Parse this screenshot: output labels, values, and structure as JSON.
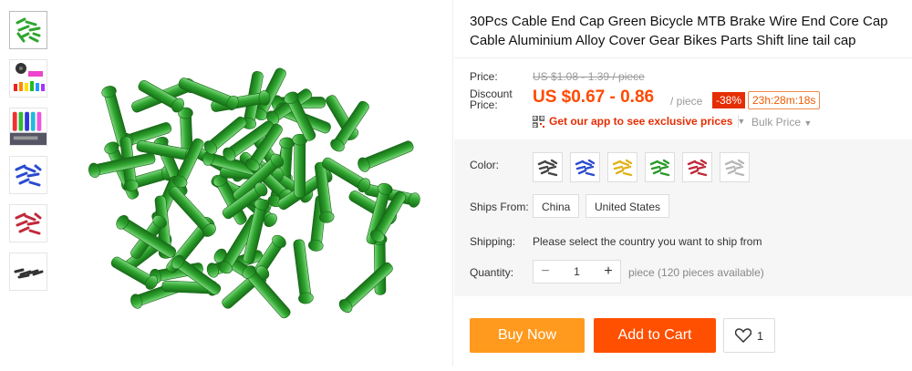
{
  "product": {
    "title": "30Pcs Cable End Cap Green Bicycle MTB Brake Wire End Core Cap Cable Aluminium Alloy Cover Gear Bikes Parts Shift line tail cap"
  },
  "thumbnails": [
    {
      "icon": "green-caps-thumb"
    },
    {
      "icon": "colorful-caps-thumb"
    },
    {
      "icon": "grips-thumb"
    },
    {
      "icon": "blue-caps-thumb"
    },
    {
      "icon": "red-caps-thumb"
    },
    {
      "icon": "black-caps-thumb"
    }
  ],
  "price": {
    "label": "Price:",
    "original": "US $1.08 - 1.39 / piece",
    "discount_label": "Discount Price:",
    "discount": "US $0.67 - 0.86",
    "unit": "/ piece",
    "off": "-38%",
    "timer": "23h:28m:18s"
  },
  "promo": {
    "app_text": "Get our app to see exclusive prices",
    "bulk_text": "Bulk Price"
  },
  "color": {
    "label": "Color:",
    "options": [
      {
        "icon": "black-swatch",
        "color": "#444444"
      },
      {
        "icon": "blue-swatch",
        "color": "#2a4bd0"
      },
      {
        "icon": "gold-swatch",
        "color": "#e0b21c"
      },
      {
        "icon": "green-swatch",
        "color": "#2c9a2c"
      },
      {
        "icon": "red-swatch",
        "color": "#c02a3a"
      },
      {
        "icon": "silver-swatch",
        "color": "#b8b8b8"
      }
    ]
  },
  "ships_from": {
    "label": "Ships From:",
    "options": [
      "China",
      "United States"
    ]
  },
  "shipping": {
    "label": "Shipping:",
    "text": "Please select the country you want to ship from"
  },
  "quantity": {
    "label": "Quantity:",
    "value": "1",
    "minus": "−",
    "plus": "+",
    "availability": "piece (120 pieces available)"
  },
  "actions": {
    "buy_now": "Buy Now",
    "add_to_cart": "Add to Cart",
    "wishlist_count": "1"
  },
  "colors": {
    "accent": "#ff4a00",
    "buy_now": "#ff9a1e",
    "add_to_cart": "#ff4f00",
    "cap_green": "#2fa52f"
  }
}
